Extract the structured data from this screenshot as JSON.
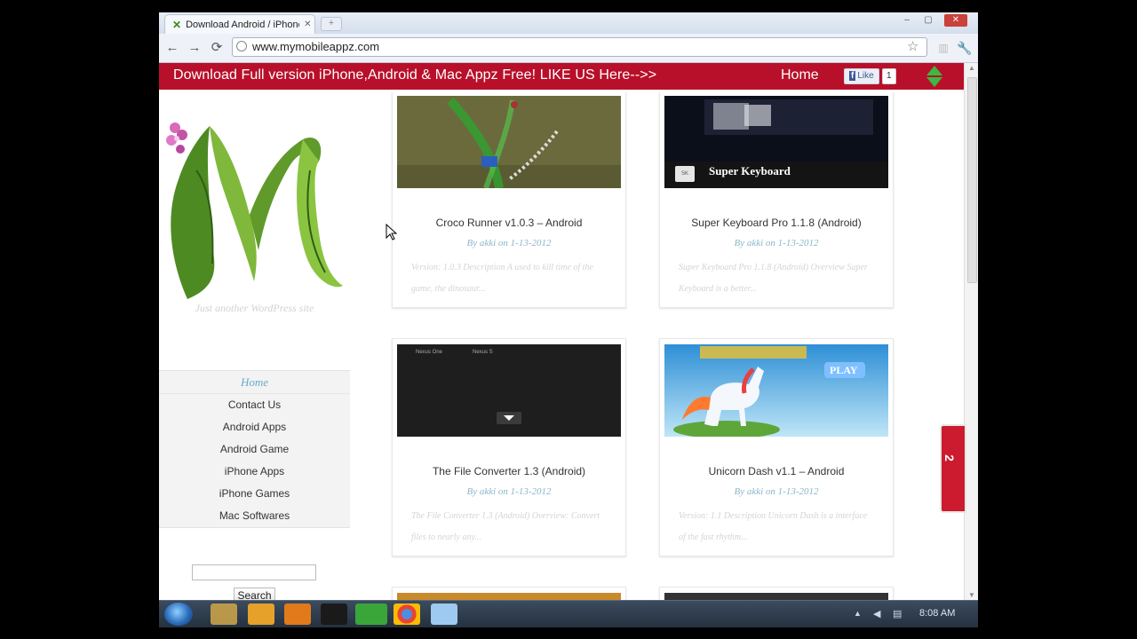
{
  "browser": {
    "tab_title": "Download Android / iPhone",
    "tab_close": "✕",
    "url": "www.mymobileappz.com",
    "window_controls": {
      "minimize": "–",
      "maximize": "▢",
      "close": "✕"
    },
    "icons": {
      "back": "back-icon",
      "forward": "forward-icon",
      "reload": "reload-icon",
      "bookmark": "star-icon",
      "wrench": "wrench-icon"
    }
  },
  "banner": {
    "message": "Download Full version iPhone,Android & Mac Appz Free! LIKE US Here-->>",
    "home_label": "Home",
    "fb_like_label": "Like",
    "fb_count": "1",
    "color": "#b8102a"
  },
  "sidebar": {
    "tagline": "Just another WordPress site",
    "menu": [
      {
        "label": "Home"
      },
      {
        "label": "Contact Us"
      },
      {
        "label": "Android Apps"
      },
      {
        "label": "Android Game"
      },
      {
        "label": "iPhone Apps"
      },
      {
        "label": "iPhone Games"
      },
      {
        "label": "Mac Softwares"
      }
    ],
    "search_placeholder": "",
    "search_button": "Search"
  },
  "posts": [
    {
      "title": "Croco Runner v1.0.3 – Android",
      "byline": "By akki on 1-13-2012",
      "excerpt": "Version: 1.0.3 Description A used to kill time of the game, the dinosaur..."
    },
    {
      "title": "Super Keyboard Pro 1.1.8 (Android)",
      "byline": "By akki on 1-13-2012",
      "excerpt": "Super Keyboard Pro 1.1.8 (Android) Overview Super Keyboard is a better...",
      "image_caption": "Super Keyboard",
      "image_badge": "SK"
    },
    {
      "title": "The File Converter 1.3 (Android)",
      "byline": "By akki on 1-13-2012",
      "excerpt": "The File Converter 1.3 (Android) Overview: Convert files to nearly any...",
      "image_labels": [
        "Nexus One",
        "Nexus S"
      ]
    },
    {
      "title": "Unicorn Dash v1.1 – Android",
      "byline": "By akki on 1-13-2012",
      "excerpt": "Version: 1.1 Description Unicorn Dash is a interface of the fast rhythm...",
      "image_caption": "PLAY"
    }
  ],
  "side_tab": {
    "label": "2"
  },
  "taskbar": {
    "clock": "8:08 AM"
  }
}
